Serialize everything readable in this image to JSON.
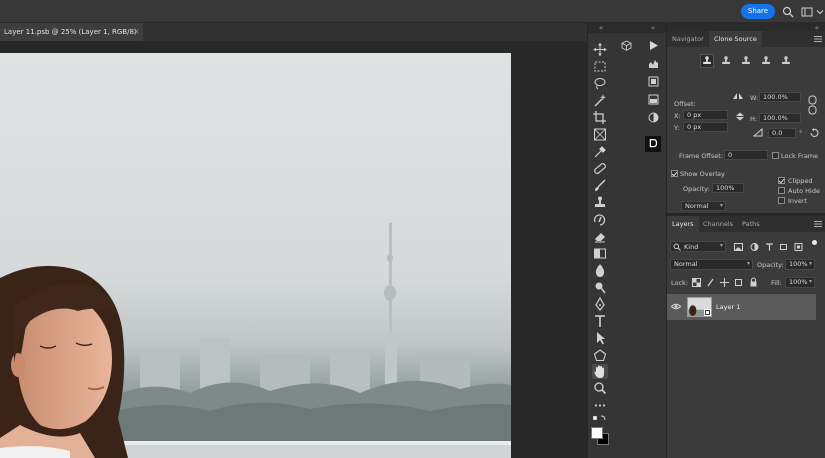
{
  "topbar": {
    "share_label": "Share"
  },
  "document": {
    "tab_title": "Layer 11.psb @ 25% (Layer 1, RGB/8)",
    "close_glyph": "×"
  },
  "collapse_glyph": "«",
  "clone_source": {
    "tabs": [
      "Navigator",
      "Clone Source"
    ],
    "offset_label": "Offset:",
    "x_label": "X:",
    "x_value": "0 px",
    "y_label": "Y:",
    "y_value": "0 px",
    "w_label": "W:",
    "w_value": "100.0%",
    "h_label": "H:",
    "h_value": "100.0%",
    "angle_value": "0.0",
    "degree_glyph": "°",
    "frame_offset_label": "Frame Offset:",
    "frame_offset_value": "0",
    "lock_frame_label": "Lock Frame",
    "show_overlay_label": "Show Overlay",
    "opacity_label": "Opacity:",
    "opacity_value": "100%",
    "blend_value": "Normal",
    "clipped_label": "Clipped",
    "auto_hide_label": "Auto Hide",
    "invert_label": "Invert"
  },
  "layers": {
    "tabs": [
      "Layers",
      "Channels",
      "Paths"
    ],
    "filter_kind": "Kind",
    "blend_mode": "Normal",
    "opacity_label": "Opacity:",
    "opacity_value": "100%",
    "lock_label": "Lock:",
    "fill_label": "Fill:",
    "fill_value": "100%",
    "layer_name": "Layer 1"
  },
  "colors": {
    "accent": "#1473e6",
    "panel_bg": "#3b3b3b",
    "app_bg": "#262626"
  }
}
